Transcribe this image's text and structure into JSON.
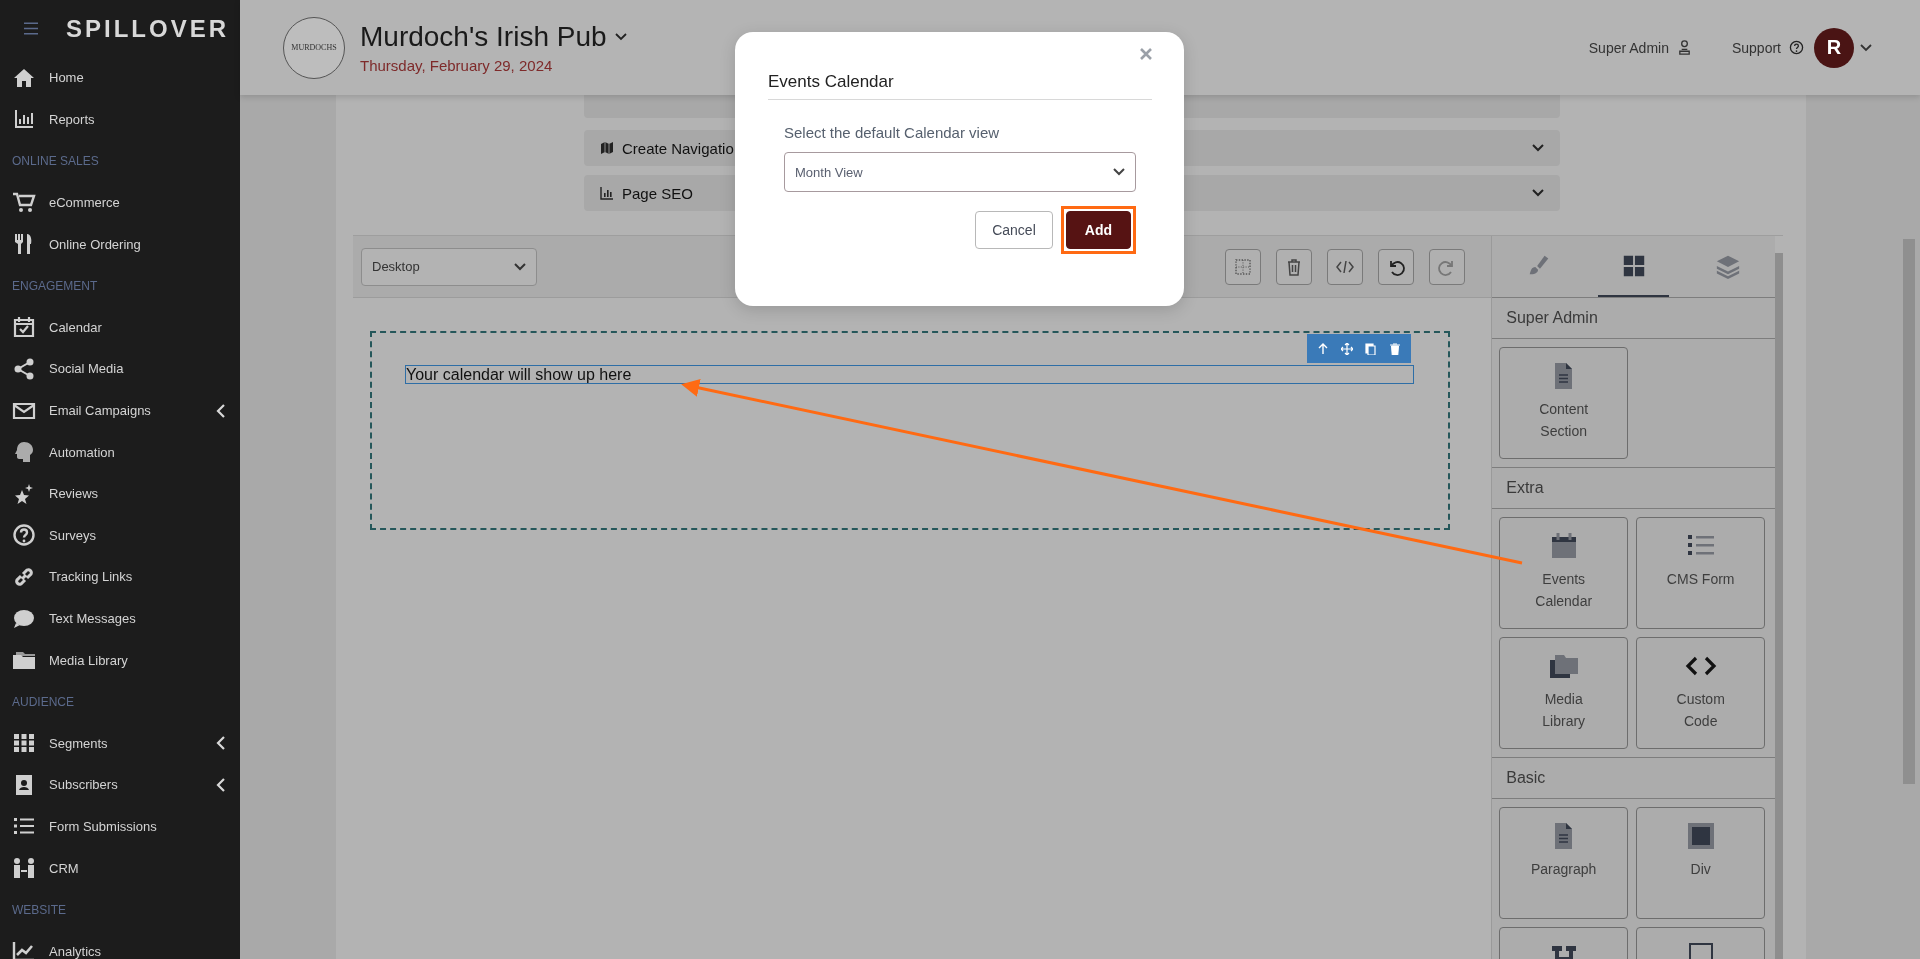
{
  "sidebar": {
    "logo": "SPILLOVER",
    "items": [
      {
        "kind": "link",
        "label": "Home",
        "expandable": false
      },
      {
        "kind": "link",
        "label": "Reports",
        "expandable": false
      },
      {
        "kind": "section",
        "label": "ONLINE SALES"
      },
      {
        "kind": "link",
        "label": "eCommerce",
        "expandable": false
      },
      {
        "kind": "link",
        "label": "Online Ordering",
        "expandable": false
      },
      {
        "kind": "section",
        "label": "ENGAGEMENT"
      },
      {
        "kind": "link",
        "label": "Calendar",
        "expandable": false
      },
      {
        "kind": "link",
        "label": "Social Media",
        "expandable": false
      },
      {
        "kind": "link",
        "label": "Email Campaigns",
        "expandable": true
      },
      {
        "kind": "link",
        "label": "Automation",
        "expandable": false
      },
      {
        "kind": "link",
        "label": "Reviews",
        "expandable": false
      },
      {
        "kind": "link",
        "label": "Surveys",
        "expandable": false
      },
      {
        "kind": "link",
        "label": "Tracking Links",
        "expandable": false
      },
      {
        "kind": "link",
        "label": "Text Messages",
        "expandable": false
      },
      {
        "kind": "link",
        "label": "Media Library",
        "expandable": false
      },
      {
        "kind": "section",
        "label": "AUDIENCE"
      },
      {
        "kind": "link",
        "label": "Segments",
        "expandable": true
      },
      {
        "kind": "link",
        "label": "Subscribers",
        "expandable": true
      },
      {
        "kind": "link",
        "label": "Form Submissions",
        "expandable": false
      },
      {
        "kind": "link",
        "label": "CRM",
        "expandable": false
      },
      {
        "kind": "section",
        "label": "WEBSITE"
      },
      {
        "kind": "link",
        "label": "Analytics",
        "expandable": false
      }
    ]
  },
  "header": {
    "logo_text": "MURDOCHS",
    "business": "Murdoch's Irish Pub",
    "date": "Thursday, February 29, 2024",
    "role": "Super Admin",
    "support": "Support",
    "avatar": "R"
  },
  "page": {
    "accordions": [
      {
        "label": "Create Navigatio"
      },
      {
        "label": "Page SEO"
      }
    ]
  },
  "editor": {
    "device": "Desktop",
    "placeholder_text": "Your calendar will show up here",
    "panel_tabs": [
      {
        "selected": false
      },
      {
        "selected": true
      },
      {
        "selected": false
      }
    ],
    "sections": [
      {
        "title": "Super Admin",
        "blocks": [
          {
            "kind": "tile",
            "label": "Content Section"
          }
        ]
      },
      {
        "title": "Extra",
        "blocks": [
          {
            "kind": "tile",
            "label": "Events Calendar"
          },
          {
            "kind": "tile",
            "label": "CMS Form"
          },
          {
            "kind": "tile",
            "label": "Media Library"
          },
          {
            "kind": "tile",
            "label": "Custom Code"
          }
        ]
      },
      {
        "title": "Basic",
        "blocks": [
          {
            "kind": "tile",
            "label": "Paragraph"
          },
          {
            "kind": "tile",
            "label": "Div"
          },
          {
            "kind": "tile"
          },
          {
            "kind": "tile"
          }
        ]
      }
    ]
  },
  "modal": {
    "title": "Events Calendar",
    "prompt": "Select the default Calendar view",
    "select_value": "Month View",
    "buttons": [
      {
        "kind": "secondary",
        "label": "Cancel",
        "highlighted": false
      },
      {
        "kind": "primary",
        "label": "Add",
        "highlighted": true
      }
    ]
  }
}
